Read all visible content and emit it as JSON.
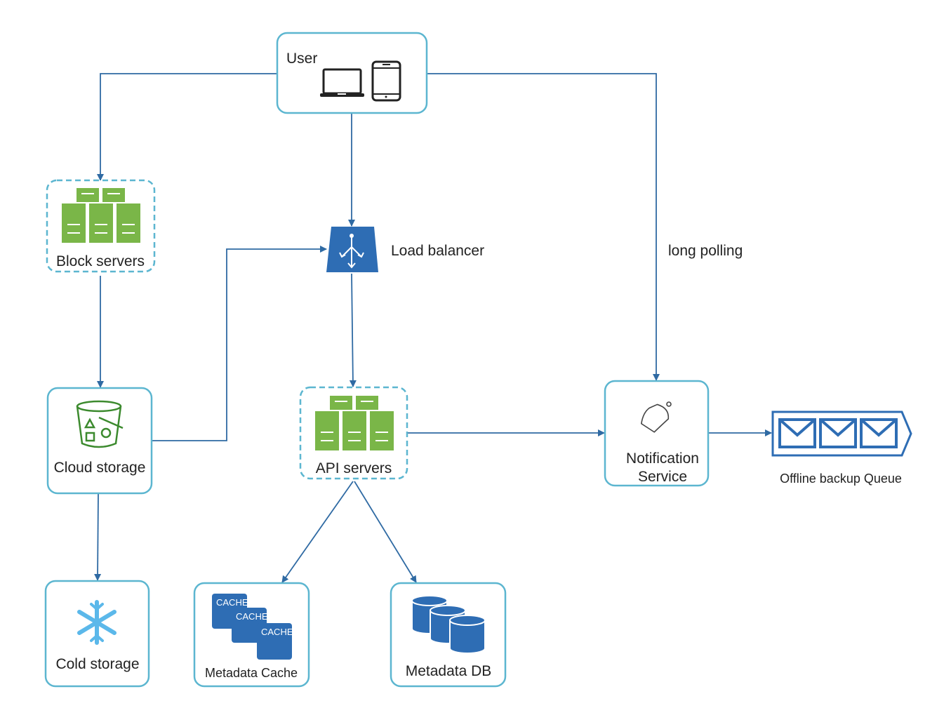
{
  "nodes": {
    "user": {
      "label": "User",
      "icons": [
        "laptop-icon",
        "phone-icon"
      ]
    },
    "block_servers": {
      "label": "Block servers",
      "icon": "server-icon"
    },
    "load_balancer": {
      "label": "Load balancer",
      "icon": "load-balancer-icon"
    },
    "cloud_storage": {
      "label": "Cloud storage",
      "icon": "bucket-icon"
    },
    "api_servers": {
      "label": "API servers",
      "icon": "server-icon"
    },
    "notification_service": {
      "label_line1": "Notification",
      "label_line2": "Service",
      "icon": "bell-icon"
    },
    "offline_queue": {
      "label": "Offline backup Queue",
      "icon": "message-queue-icon"
    },
    "cold_storage": {
      "label": "Cold storage",
      "icon": "snowflake-icon"
    },
    "metadata_cache": {
      "label": "Metadata Cache",
      "icon_text": "CACHE"
    },
    "metadata_db": {
      "label": "Metadata DB",
      "icon": "database-icon"
    }
  },
  "edges": {
    "long_polling": "long polling"
  },
  "colors": {
    "box_border": "#5cb6d0",
    "arrow": "#2f6aa3",
    "server_green": "#7ab648",
    "icon_blue": "#2e6db4",
    "snowflake": "#5bb8ea"
  }
}
